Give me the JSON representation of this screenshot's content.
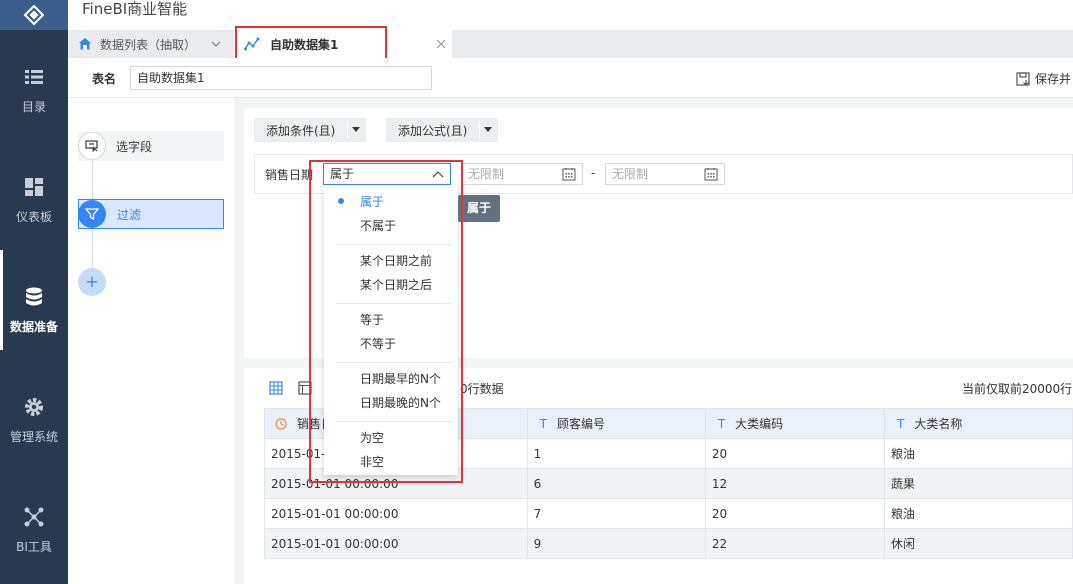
{
  "app": {
    "title": "FineBI商业智能"
  },
  "sidebar": {
    "items": [
      {
        "label": "目录",
        "icon": "list-icon"
      },
      {
        "label": "仪表板",
        "icon": "dashboard-icon"
      },
      {
        "label": "数据准备",
        "icon": "database-icon",
        "active": true
      },
      {
        "label": "管理系统",
        "icon": "gear-icon"
      },
      {
        "label": "BI工具",
        "icon": "bi-tools-icon"
      }
    ]
  },
  "tabs": [
    {
      "label": "数据列表（抽取）"
    },
    {
      "label": "自助数据集1"
    }
  ],
  "dataset": {
    "name_label": "表名",
    "name_value": "自助数据集1",
    "save_label": "保存并"
  },
  "steps": [
    {
      "label": "选字段"
    },
    {
      "label": "过滤"
    },
    {
      "label": "+"
    }
  ],
  "toolbar": {
    "add_condition": "添加条件(且)",
    "add_formula": "添加公式(且)"
  },
  "filter": {
    "field_label": "销售日期",
    "operator": "属于",
    "start_placeholder": "无限制",
    "dash": "-",
    "end_placeholder": "无限制",
    "tooltip": "属于"
  },
  "dropdown": {
    "items": [
      {
        "label": "属于",
        "selected": true
      },
      {
        "label": "不属于"
      },
      {
        "label": "某个日期之前"
      },
      {
        "label": "某个日期之后"
      },
      {
        "label": "等于"
      },
      {
        "label": "不等于"
      },
      {
        "label": "日期最早的N个"
      },
      {
        "label": "日期最晚的N个"
      },
      {
        "label": "为空"
      },
      {
        "label": "非空"
      }
    ]
  },
  "preview": {
    "info": "0行数据",
    "right_info": "当前仅取前20000行",
    "columns": [
      {
        "label": "销售日",
        "type_icon": "clock-icon"
      },
      {
        "label": "顾客编号",
        "type_icon": "T"
      },
      {
        "label": "大类编码",
        "type_icon": "T"
      },
      {
        "label": "大类名称",
        "type_icon": "T"
      }
    ],
    "rows": [
      [
        "2015-01-0",
        "1",
        "20",
        "粮油"
      ],
      [
        "2015-01-01 00:00:00",
        "6",
        "12",
        "蔬果"
      ],
      [
        "2015-01-01 00:00:00",
        "7",
        "20",
        "粮油"
      ],
      [
        "2015-01-01 00:00:00",
        "9",
        "22",
        "休闲"
      ]
    ]
  },
  "colors": {
    "accent": "#3685f2",
    "sidebar": "#293a4e",
    "highlight": "#e0343d"
  }
}
